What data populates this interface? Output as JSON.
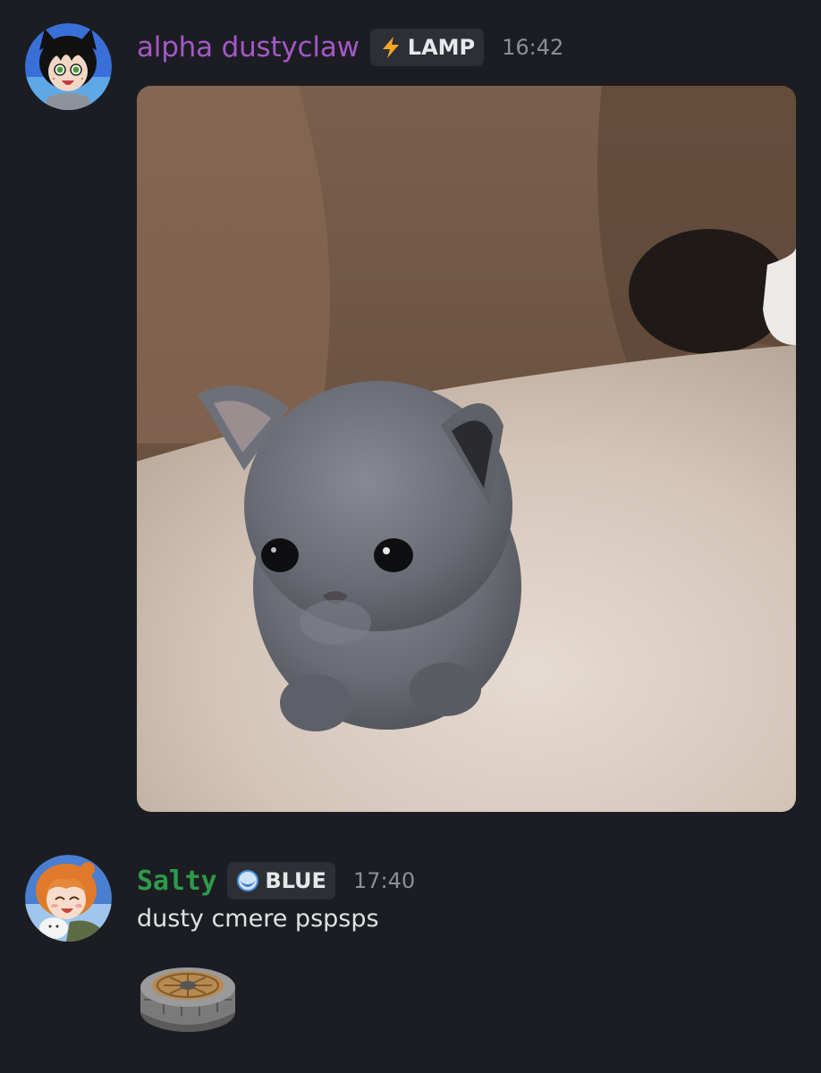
{
  "messages": [
    {
      "author": "alpha dustyclaw",
      "role": {
        "icon": "lightning-bolt-icon",
        "label": "LAMP",
        "icon_color": "#f5a524"
      },
      "timestamp": "16:42",
      "name_color": "#a458c6",
      "attachment": {
        "type": "gif",
        "subject": "kitten-image"
      }
    },
    {
      "author": "Salty",
      "role": {
        "icon": "blue-orb-icon",
        "label": "BLUE",
        "icon_color": "#4a90d9"
      },
      "timestamp": "17:40",
      "name_color": "#2e9a4a",
      "text": "dusty cmere pspsps",
      "sticker": {
        "type": "sticker",
        "subject": "stone-pressure-plate-sticker"
      }
    }
  ],
  "colors": {
    "background": "#1c1d22",
    "role_tag_bg": "#2d2f36",
    "timestamp": "#8c8f96",
    "text": "#dfe1e5"
  }
}
